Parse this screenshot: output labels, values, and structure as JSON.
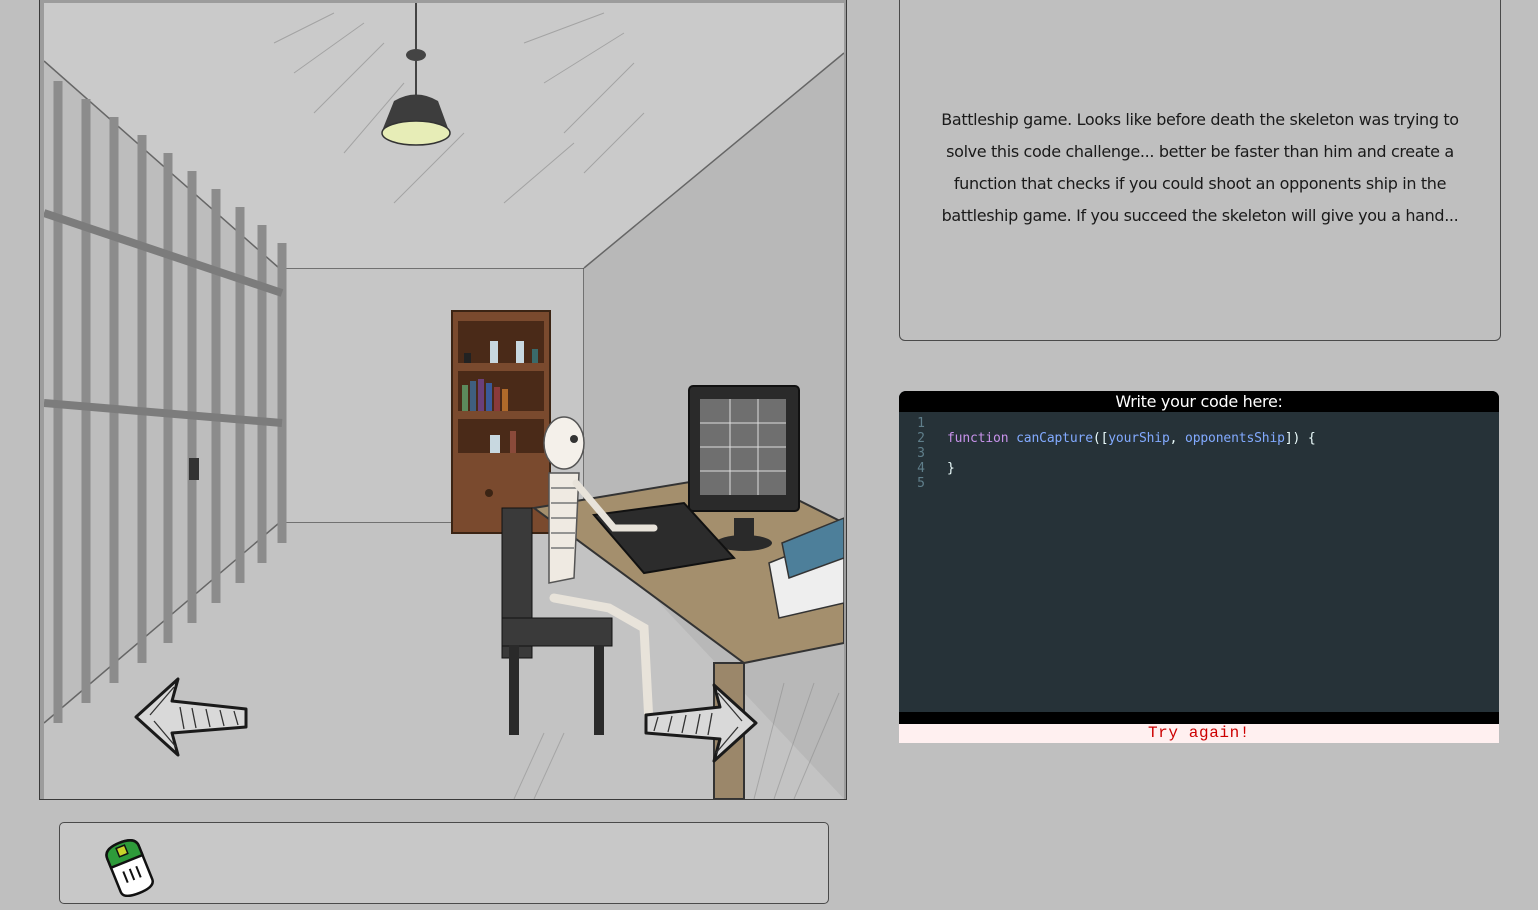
{
  "story": {
    "text": "Battleship game. Looks like before death the skeleton was trying to solve this code challenge... better be faster than him and create a function that checks if you could shoot an opponents ship in the battleship game. If you succeed the skeleton will give you a hand..."
  },
  "editor": {
    "header": "Write your code here:",
    "lines": [
      {
        "num": "1",
        "text": ""
      },
      {
        "num": "2",
        "keyword": "function",
        "fn": "canCapture",
        "p1": "([",
        "arg1": "yourShip",
        "sep": ", ",
        "arg2": "opponentsShip",
        "p2": "]) {"
      },
      {
        "num": "3",
        "text": ""
      },
      {
        "num": "4",
        "text": "}"
      },
      {
        "num": "5",
        "text": ""
      }
    ],
    "result": "Try again!"
  },
  "scene": {
    "left_arrow_icon": "arrow-left-icon",
    "right_arrow_icon": "arrow-right-icon"
  },
  "inventory": {
    "items": [
      {
        "icon": "mouse-icon"
      }
    ]
  },
  "colors": {
    "background": "#bfbfbf",
    "editor_bg": "#263238",
    "keyword": "#c792ea",
    "function": "#82aaff",
    "error": "#cc0000"
  }
}
